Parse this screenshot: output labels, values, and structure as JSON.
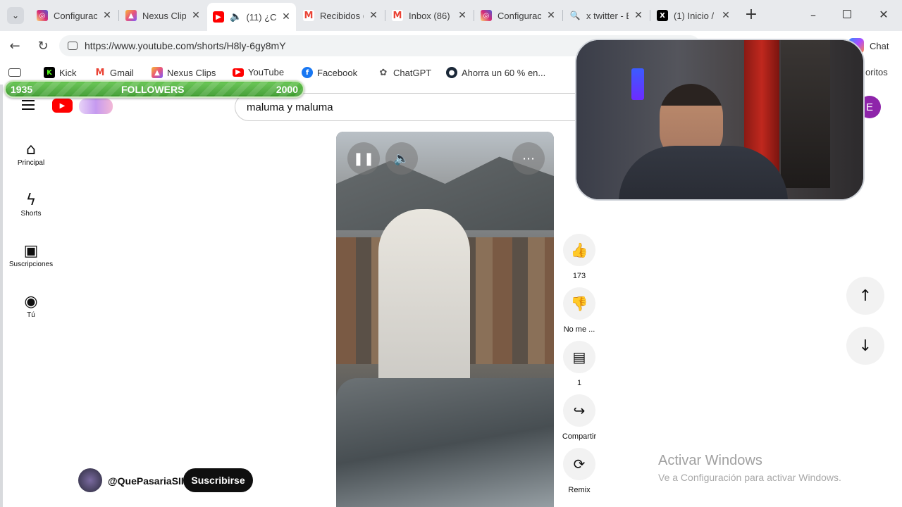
{
  "tabs": [
    {
      "title": "Configurac",
      "icon": "instagram-icon",
      "color": "#d62976"
    },
    {
      "title": "Nexus Clip",
      "icon": "nexus-clips-icon",
      "color": "#e9547a"
    },
    {
      "title": "(11) ¿C",
      "icon": "youtube-icon",
      "color": "#ff0000",
      "active": true
    },
    {
      "title": "Recibidos (",
      "icon": "gmail-icon",
      "color": "#ea4335"
    },
    {
      "title": "Inbox (86)",
      "icon": "gmail-icon",
      "color": "#ea4335"
    },
    {
      "title": "Configurac",
      "icon": "instagram-icon",
      "color": "#d62976"
    },
    {
      "title": "x twitter - B",
      "icon": "search-icon",
      "color": "#1a73e8"
    },
    {
      "title": "(1) Inicio /",
      "icon": "x-icon",
      "color": "#000000"
    }
  ],
  "toolbar": {
    "url": "https://www.youtube.com/shorts/H8ly-6gy8mY",
    "chat_label": "Chat"
  },
  "bookmarks": [
    {
      "label": "Kick",
      "icon": "kick-icon",
      "color": "#53fc18"
    },
    {
      "label": "Gmail",
      "icon": "gmail-icon",
      "color": "#ea4335"
    },
    {
      "label": "Nexus Clips",
      "icon": "nexus-clips-icon",
      "color": "#e9547a"
    },
    {
      "label": "YouTube",
      "icon": "youtube-icon",
      "color": "#ff0000"
    },
    {
      "label": "Facebook",
      "icon": "facebook-icon",
      "color": "#1877f2"
    },
    {
      "label": "ChatGPT",
      "icon": "chatgpt-icon",
      "color": "#555555"
    },
    {
      "label": "Ahorra un 60 % en...",
      "icon": "steam-icon",
      "color": "#1b2838"
    }
  ],
  "bookmarks_overflow": "oritos",
  "followers": {
    "current": "1935",
    "label": "FOLLOWERS",
    "goal": "2000",
    "progress": 0.9675
  },
  "youtube": {
    "search_value": "maluma y maluma",
    "avatar_letter": "E",
    "sidebar": [
      {
        "label": "Principal",
        "icon": "home-icon"
      },
      {
        "label": "Shorts",
        "icon": "shorts-icon"
      },
      {
        "label": "Suscripciones",
        "icon": "subscriptions-icon"
      },
      {
        "label": "Tú",
        "icon": "account-icon"
      }
    ],
    "channel_name": "@QuePasariaSII",
    "subscribe_label": "Suscribirse",
    "actions": [
      {
        "label": "173",
        "icon": "like-icon"
      },
      {
        "label": "No me ...",
        "icon": "dislike-icon"
      },
      {
        "label": "1",
        "icon": "comment-icon"
      },
      {
        "label": "Compartir",
        "icon": "share-icon"
      },
      {
        "label": "Remix",
        "icon": "remix-icon"
      }
    ]
  },
  "watermark": {
    "title": "Activar Windows",
    "subtitle": "Ve a Configuración para activar Windows."
  }
}
